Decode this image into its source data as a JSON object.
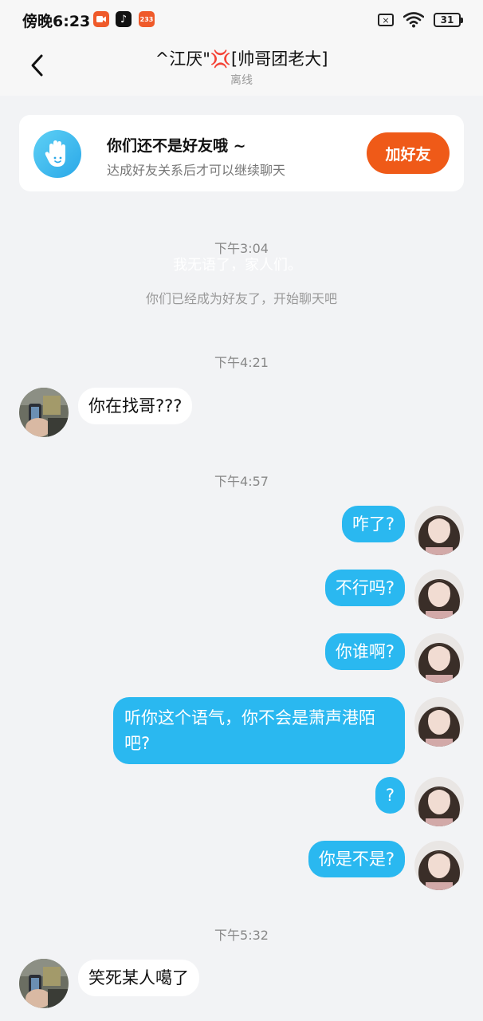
{
  "status_bar": {
    "time": "傍晚6:23",
    "app_badge": "233",
    "battery": "31"
  },
  "header": {
    "title": "^江厌\"💢[帅哥团老大]",
    "status": "离线"
  },
  "friend_card": {
    "title": "你们还不是好友哦 ~",
    "subtitle": "达成好友关系后才可以继续聊天",
    "button": "加好友"
  },
  "chat": {
    "time_1": "下午3:04",
    "ghost": "我无语了，家人们。",
    "system": "你们已经成为好友了，开始聊天吧",
    "time_2": "下午4:21",
    "msg_1": "你在找哥???",
    "time_3": "下午4:57",
    "msg_2": "咋了?",
    "msg_3": "不行吗?",
    "msg_4": "你谁啊?",
    "msg_5": "听你这个语气，你不会是萧声港陌吧?",
    "msg_6": "?",
    "msg_7": "你是不是?",
    "time_4": "下午5:32",
    "msg_8": "笑死某人噶了"
  },
  "colors": {
    "accent_blue": "#2ab8f0",
    "add_button": "#ef5a18",
    "background": "#f2f3f5"
  }
}
